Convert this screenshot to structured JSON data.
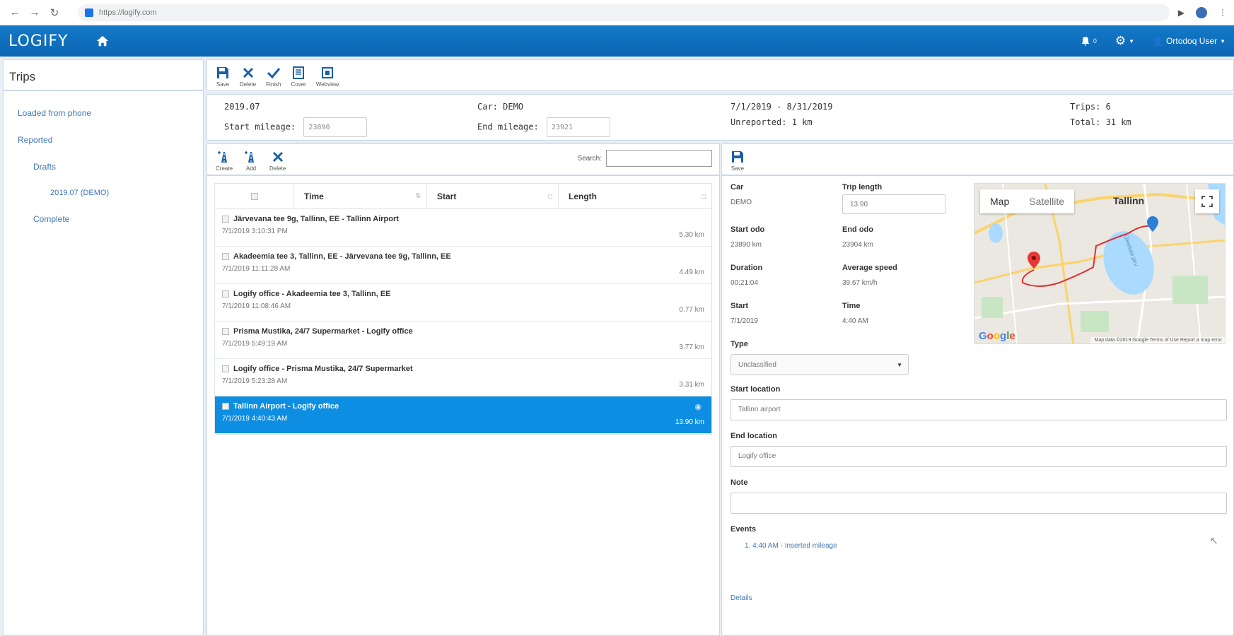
{
  "browser": {
    "url": "https://logify.com"
  },
  "app": {
    "logo": "LOGIFY"
  },
  "header": {
    "notifications_count": "0",
    "user_label": "Ortodoq User",
    "colors": {
      "bar": "#0b66b4",
      "selected_row": "#0d8ee2"
    }
  },
  "sidebar": {
    "title": "Trips",
    "items": [
      {
        "label": "Loaded from phone"
      },
      {
        "label": "Reported"
      },
      {
        "label": "Drafts"
      },
      {
        "label": "2019.07 (DEMO)"
      },
      {
        "label": "Complete"
      }
    ]
  },
  "toolbar": {
    "save": "Save",
    "delete": "Delete",
    "finish": "Finish",
    "cover": "Cover",
    "webview": "Webview"
  },
  "summary": {
    "period_code": "2019.07",
    "start_mileage_label": "Start mileage:",
    "start_mileage_value": "23890",
    "car": "Car: DEMO",
    "end_mileage_label": "End mileage:",
    "end_mileage_value": "23921",
    "date_range": "7/1/2019 - 8/31/2019",
    "unreported": "Unreported: 1 km",
    "trips": "Trips: 6",
    "total": "Total: 31 km"
  },
  "trip_toolbar": {
    "create": "Create",
    "add": "Add",
    "delete": "Delete",
    "search_label": "Search:",
    "search_value": ""
  },
  "trip_table": {
    "columns": [
      "Time",
      "Start",
      "Length"
    ],
    "rows": [
      {
        "title": "Järvevana tee 9g, Tallinn, EE - Tallinn Airport",
        "date": "7/1/2019 3:10:31 PM",
        "length": "5.30 km"
      },
      {
        "title": "Akadeemia tee 3, Tallinn, EE - Järvevana tee 9g, Tallinn, EE",
        "date": "7/1/2019 11:11:28 AM",
        "length": "4.49 km"
      },
      {
        "title": "Logify office - Akadeemia tee 3, Tallinn, EE",
        "date": "7/1/2019 11:08:46 AM",
        "length": "0.77 km"
      },
      {
        "title": "Prisma Mustika, 24/7 Supermarket - Logify office",
        "date": "7/1/2019 5:49:19 AM",
        "length": "3.77 km"
      },
      {
        "title": "Logify office - Prisma Mustika, 24/7 Supermarket",
        "date": "7/1/2019 5:23:28 AM",
        "length": "3.31 km"
      },
      {
        "title": "Tallinn Airport - Logify office",
        "date": "7/1/2019 4:40:43 AM",
        "length": "13.90 km"
      }
    ]
  },
  "detail": {
    "save": "Save",
    "car_label": "Car",
    "car_value": "DEMO",
    "trip_length_label": "Trip length",
    "trip_length_value": "13.90",
    "start_odo_label": "Start odo",
    "start_odo_value": "23890 km",
    "end_odo_label": "End odo",
    "end_odo_value": "23904 km",
    "duration_label": "Duration",
    "duration_value": "00:21:04",
    "avg_speed_label": "Average speed",
    "avg_speed_value": "39.67 km/h",
    "start_label": "Start",
    "start_value": "7/1/2019",
    "time_label": "Time",
    "time_value": "4:40 AM",
    "type_label": "Type",
    "type_value": "Unclassified",
    "start_location_label": "Start location",
    "start_location_value": "Tallinn airport",
    "end_location_label": "End location",
    "end_location_value": "Logify office",
    "note_label": "Note",
    "note_value": "",
    "events_label": "Events",
    "events": [
      {
        "text": "1.  4:40 AM - Inserted mileage"
      }
    ],
    "details_link": "Details"
  },
  "map": {
    "tab_map": "Map",
    "tab_satellite": "Satellite",
    "city": "Tallinn",
    "lake": "Ülemiste järv",
    "google": "Google",
    "footer": "Map data ©2019 Google   Terms of Use   Report a map error"
  }
}
